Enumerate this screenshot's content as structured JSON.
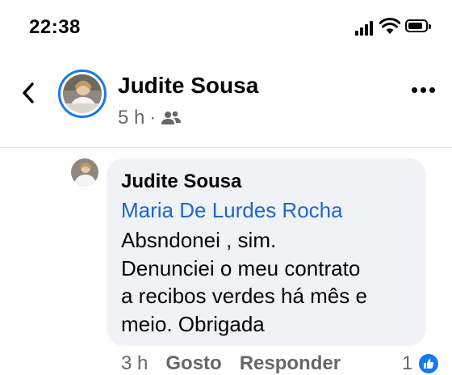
{
  "status_bar": {
    "time": "22:38",
    "battery_level": 0.75
  },
  "header": {
    "name": "Judite Sousa",
    "age": "5 h",
    "separator": "·",
    "audience_icon": "friends-icon"
  },
  "comment": {
    "author": "Judite Sousa",
    "mention": "Maria De Lurdes Rocha",
    "lines": [
      "Absndonei , sim.",
      "Denunciei o meu contrato",
      "a recibos verdes há mês e",
      "meio. Obrigada"
    ],
    "time_ago": "3 h",
    "like_label": "Gosto",
    "reply_label": "Responder",
    "like_count": "1"
  },
  "colors": {
    "accent": "#1877f2",
    "link": "#1d67c9",
    "bubble": "#f0f2f5",
    "muted": "#65676b"
  }
}
